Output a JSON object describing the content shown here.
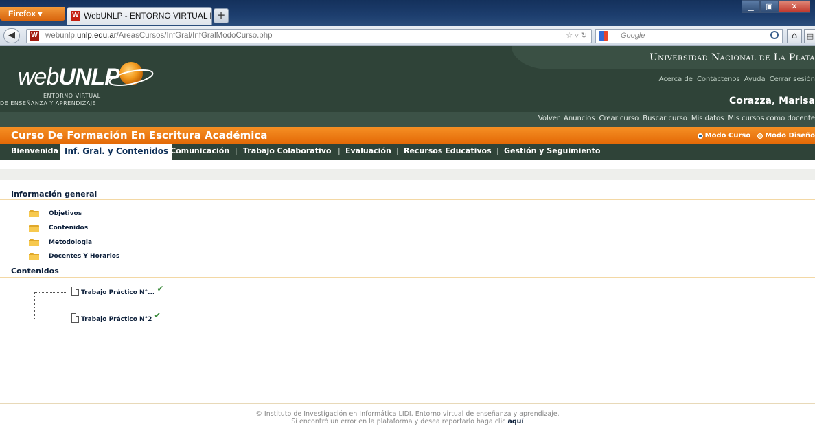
{
  "browser": {
    "app_button": "Firefox",
    "tab_title": "WebUNLP - ENTORNO VIRTUAL DE ENS...",
    "url_prefix": "webunlp.",
    "url_domain": "unlp.edu.ar",
    "url_path": "/AreasCursos/InfGral/InfGralModoCurso.php",
    "search_placeholder": "Google"
  },
  "header": {
    "university": "Universidad Nacional de La Plata",
    "logo_light": "web",
    "logo_bold": "UNLP",
    "logo_sub1": "ENTORNO VIRTUAL",
    "logo_sub2": "DE ENSEÑANZA Y APRENDIZAJE",
    "top_links": [
      "Acerca de",
      "Contáctenos",
      "Ayuda",
      "Cerrar sesión"
    ],
    "user": "Corazza, Marisa",
    "menu_links": [
      "Volver",
      "Anuncios",
      "Crear curso",
      "Buscar curso",
      "Mis datos",
      "Mis cursos como docente"
    ]
  },
  "course": {
    "title": "Curso De Formación En Escritura Académica",
    "modes": [
      "Modo Curso",
      "Modo Diseño"
    ]
  },
  "tabs": [
    "Bienvenida",
    "Inf. Gral. y Contenidos",
    "Comunicación",
    "Trabajo Colaborativo",
    "Evaluación",
    "Recursos Educativos",
    "Gestión y Seguimiento"
  ],
  "info": {
    "heading": "Información general",
    "items": [
      "Objetivos",
      "Contenidos",
      "Metodologia",
      "Docentes Y Horarios"
    ]
  },
  "contents": {
    "heading": "Contenidos",
    "items": [
      "Trabajo Práctico N°...",
      "Trabajo Práctico N°2"
    ]
  },
  "footer": {
    "line1": "© Instituto de Investigación en Informática LIDI. Entorno virtual de enseñanza y aprendizaje.",
    "line2": "Si encontró un error en la plataforma y desea reportarlo haga clic",
    "link": "aquí"
  },
  "colors": {
    "header_dark": "#2f4338",
    "orange": "#f08020",
    "tab_active_text": "#0c2e57",
    "check_green": "#3a8a3a"
  }
}
